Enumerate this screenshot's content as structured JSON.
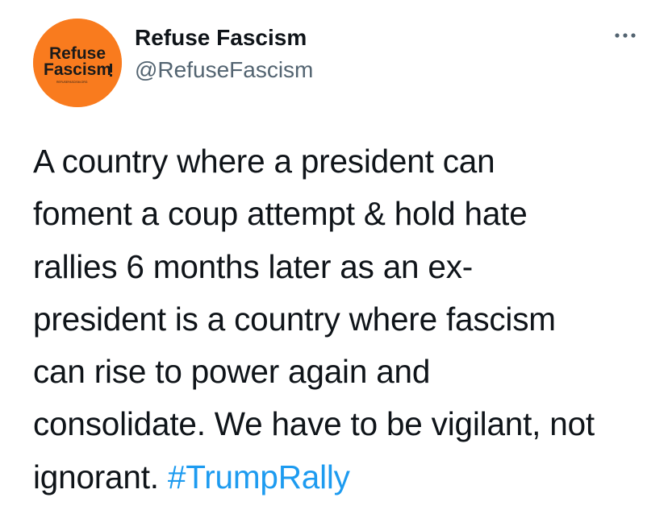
{
  "colors": {
    "avatar_bg": "#f97b1e",
    "text": "#0f1419",
    "handle": "#536471",
    "link": "#1d9bf0"
  },
  "avatar": {
    "logo_line1": "Refuse",
    "logo_line2": "Fascism",
    "logo_small": "REFUSEFASCISM.ORG"
  },
  "author": {
    "display_name": "Refuse Fascism",
    "handle": "@RefuseFascism"
  },
  "menu": {
    "icon": "more-horizontal-icon"
  },
  "tweet": {
    "lines": [
      "A country where a president can",
      "foment a coup attempt & hold hate",
      "rallies 6 months later as an ex-",
      "president is a country where fascism",
      "can rise to power again and",
      "consolidate. We have to be vigilant, not"
    ],
    "last_line_text": "ignorant.",
    "hashtag": "#TrumpRally"
  }
}
